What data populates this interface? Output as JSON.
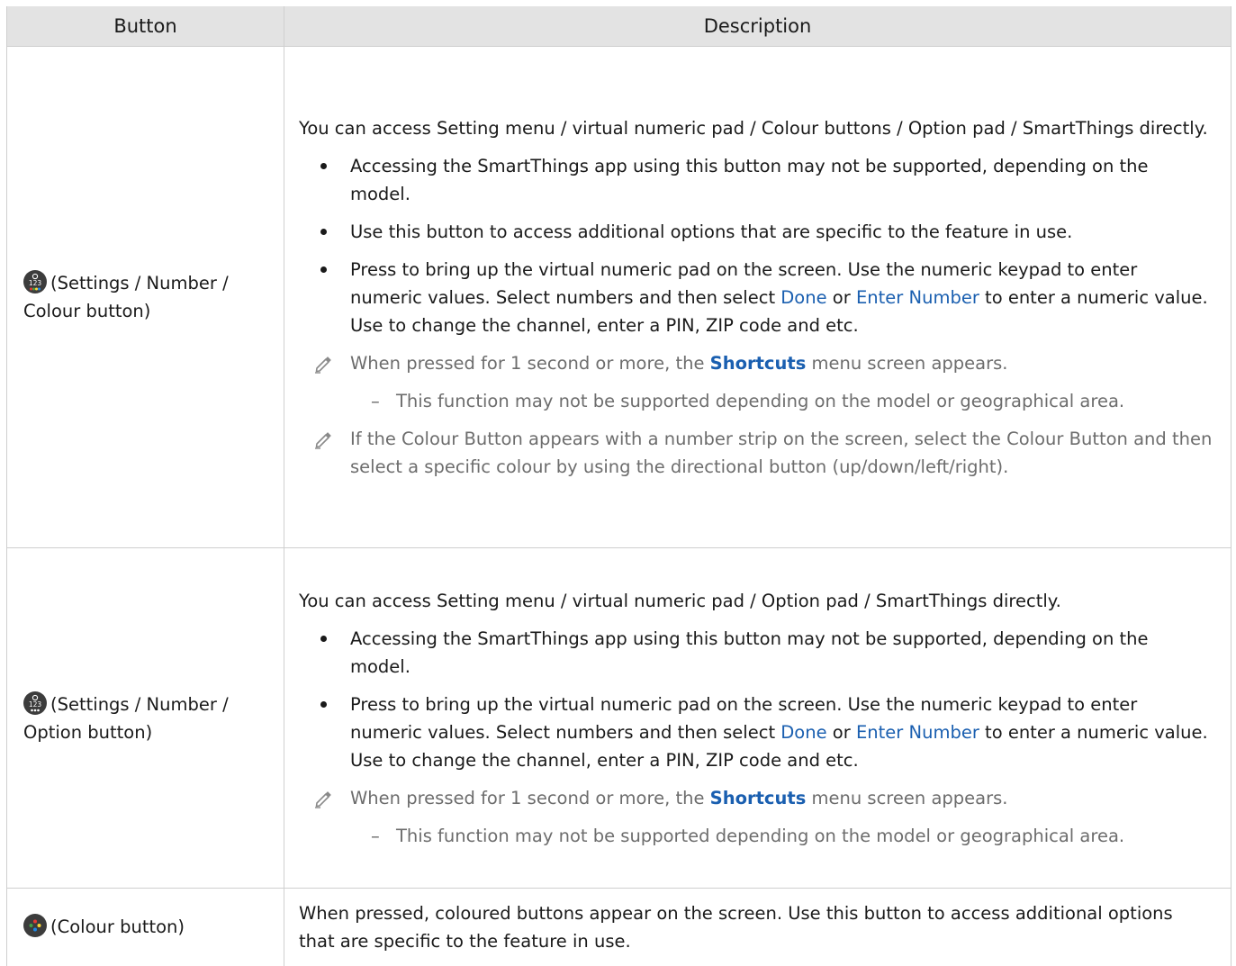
{
  "headers": {
    "button": "Button",
    "description": "Description"
  },
  "colors": {
    "link": "#1a5fb0",
    "header_bg": "#e3e3e3",
    "note_text": "#6d6d6d"
  },
  "rows": [
    {
      "icon": "settings-number-colour-icon",
      "button_label": "(Settings / Number / Colour button)",
      "intro": "You can access Setting menu / virtual numeric pad / Colour buttons / Option pad / SmartThings directly.",
      "bullets": [
        "Accessing the SmartThings app using this button may not be supported, depending on the model.",
        "Use this button to access additional options that are specific to the feature in use."
      ],
      "bullet_numeric": {
        "part1": "Press to bring up the virtual numeric pad on the screen. Use the numeric keypad to enter numeric values. Select numbers and then select ",
        "link1": "Done",
        "part2": " or ",
        "link2": "Enter Number",
        "part3": " to enter a numeric value. Use to change the channel, enter a PIN, ZIP code and etc."
      },
      "note1": {
        "part1": "When pressed for 1 second or more, the ",
        "link": "Shortcuts",
        "part2": " menu screen appears."
      },
      "subnote": "This function may not be supported depending on the model or geographical area.",
      "note2": "If the Colour Button appears with a number strip on the screen, select the Colour Button and then select a specific colour by using the directional button (up/down/left/right)."
    },
    {
      "icon": "settings-number-option-icon",
      "button_label": "(Settings / Number / Option button)",
      "intro": "You can access Setting menu / virtual numeric pad / Option pad / SmartThings directly.",
      "bullets": [
        "Accessing the SmartThings app using this button may not be supported, depending on the model."
      ],
      "bullet_numeric": {
        "part1": "Press to bring up the virtual numeric pad on the screen. Use the numeric keypad to enter numeric values. Select numbers and then select ",
        "link1": "Done",
        "part2": " or ",
        "link2": "Enter Number",
        "part3": " to enter a numeric value. Use to change the channel, enter a PIN, ZIP code and etc."
      },
      "note1": {
        "part1": "When pressed for 1 second or more, the ",
        "link": "Shortcuts",
        "part2": " menu screen appears."
      },
      "subnote": "This function may not be supported depending on the model or geographical area."
    },
    {
      "icon": "colour-button-icon",
      "button_label": "(Colour button)",
      "intro": "When pressed, coloured buttons appear on the screen. Use this button to access additional options that are specific to the feature in use."
    }
  ]
}
